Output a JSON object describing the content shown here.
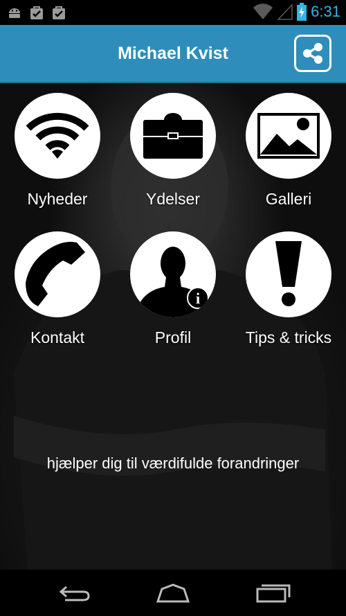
{
  "status_bar": {
    "time": "6:31",
    "accent_color": "#34b5e5",
    "icons": [
      "android-icon",
      "bag-check-icon",
      "bag-check-icon",
      "wifi-signal-icon",
      "cell-signal-icon",
      "battery-charging-icon"
    ]
  },
  "header": {
    "title": "Michael Kvist",
    "share_icon": "share-icon",
    "bar_color": "#2e8dbb"
  },
  "menu": {
    "items": [
      {
        "label": "Nyheder",
        "icon": "wifi-icon"
      },
      {
        "label": "Ydelser",
        "icon": "briefcase-icon"
      },
      {
        "label": "Galleri",
        "icon": "image-icon"
      },
      {
        "label": "Kontakt",
        "icon": "phone-icon"
      },
      {
        "label": "Profil",
        "icon": "profile-info-icon"
      },
      {
        "label": "Tips & tricks",
        "icon": "exclamation-icon"
      }
    ]
  },
  "tagline": "hjælper dig til værdifulde forandringer",
  "nav_bar": {
    "icons": [
      "back-icon",
      "home-icon",
      "recent-apps-icon"
    ]
  }
}
